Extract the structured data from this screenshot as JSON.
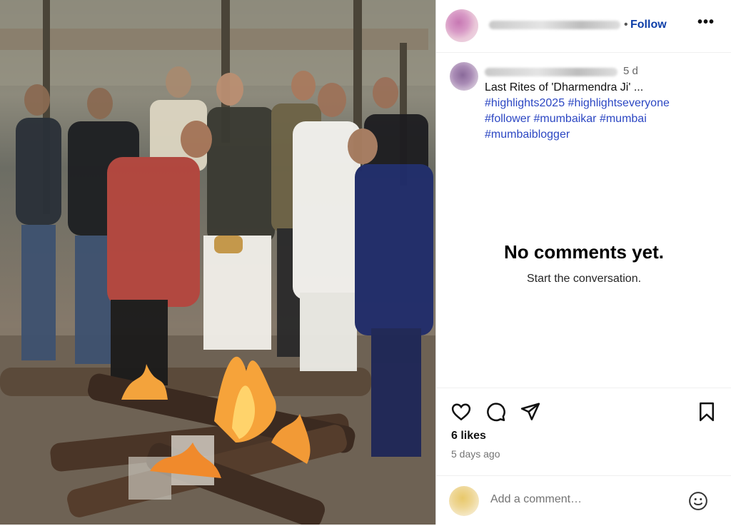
{
  "post": {
    "photo_alt": "photo",
    "header": {
      "follow_label": "Follow",
      "separator": "•",
      "more_label": "•••",
      "avatar_icon": "profile-avatar-blurred",
      "username_blurred": true
    },
    "caption": {
      "time": "5 d",
      "text": "Last Rites of 'Dharmendra Ji' ...",
      "hashtags": "#highlights2025 #highlightseveryone #follower #mumbaikar #mumbai #mumbaiblogger"
    },
    "comments_empty": {
      "title": "No comments yet.",
      "subtitle": "Start the conversation."
    },
    "actions": {
      "like_icon": "heart-icon",
      "comment_icon": "comment-icon",
      "share_icon": "send-icon",
      "save_icon": "bookmark-icon",
      "likes": "6 likes",
      "posted_ago": "5 days ago"
    },
    "comment_input": {
      "placeholder": "Add a comment…",
      "emoji_icon": "emoji-icon"
    }
  },
  "colors": {
    "link": "#0f3fa8",
    "hashtag": "#2c47c3",
    "muted": "#737373"
  }
}
